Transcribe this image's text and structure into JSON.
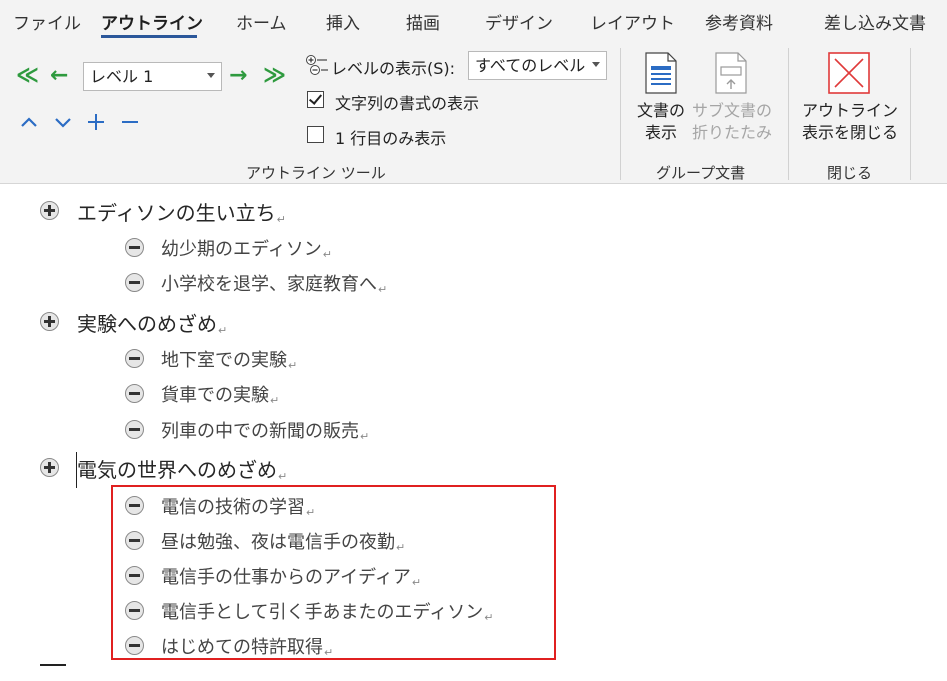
{
  "tabs": [
    {
      "label": "ファイル"
    },
    {
      "label": "アウトライン"
    },
    {
      "label": "ホーム"
    },
    {
      "label": "挿入"
    },
    {
      "label": "描画"
    },
    {
      "label": "デザイン"
    },
    {
      "label": "レイアウト"
    },
    {
      "label": "参考資料"
    },
    {
      "label": "差し込み文書"
    }
  ],
  "active_tab": "アウトライン",
  "outline_tools": {
    "promote_to_heading1_icon": "≪",
    "promote_icon": "←",
    "level_value": "レベル 1",
    "demote_icon": "→",
    "demote_to_body_icon": "≫",
    "move_up_icon": "^",
    "move_down_icon": "v",
    "expand_icon": "+",
    "collapse_icon": "−",
    "show_level_label": "レベルの表示(S):",
    "show_level_value": "すべてのレベル",
    "show_formatting_label": "文字列の書式の表示",
    "show_formatting_checked": true,
    "first_line_only_label": "1 行目のみ表示",
    "first_line_only_checked": false,
    "group_label": "アウトライン ツール"
  },
  "master_document": {
    "show_document_label_line1": "文書の",
    "show_document_label_line2": "表示",
    "collapse_subdocs_label_line1": "サブ文書の",
    "collapse_subdocs_label_line2": "折りたたみ",
    "group_label": "グループ文書"
  },
  "close": {
    "close_outline_label_line1": "アウトライン",
    "close_outline_label_line2": "表示を閉じる",
    "group_label": "閉じる"
  },
  "paragraph_mark": "↵",
  "outline": [
    {
      "level": 1,
      "text": "エディソンの生い立ち"
    },
    {
      "level": 2,
      "text": "幼少期のエディソン"
    },
    {
      "level": 2,
      "text": "小学校を退学、家庭教育へ"
    },
    {
      "level": 1,
      "text": "実験へのめざめ"
    },
    {
      "level": 2,
      "text": "地下室での実験"
    },
    {
      "level": 2,
      "text": "貨車での実験"
    },
    {
      "level": 2,
      "text": "列車の中での新聞の販売"
    },
    {
      "level": 1,
      "text": "電気の世界へのめざめ"
    },
    {
      "level": 2,
      "text": "電信の技術の学習"
    },
    {
      "level": 2,
      "text": "昼は勉強、夜は電信手の夜勤"
    },
    {
      "level": 2,
      "text": "電信手の仕事からのアイディア"
    },
    {
      "level": 2,
      "text": "電信手として引く手あまたのエディソン"
    },
    {
      "level": 2,
      "text": "はじめての特許取得"
    }
  ],
  "colors": {
    "accent": "#2b579a",
    "highlight_box": "#e02020",
    "arrow_green": "#2e9a3e",
    "arrow_blue": "#2b6cc4"
  }
}
